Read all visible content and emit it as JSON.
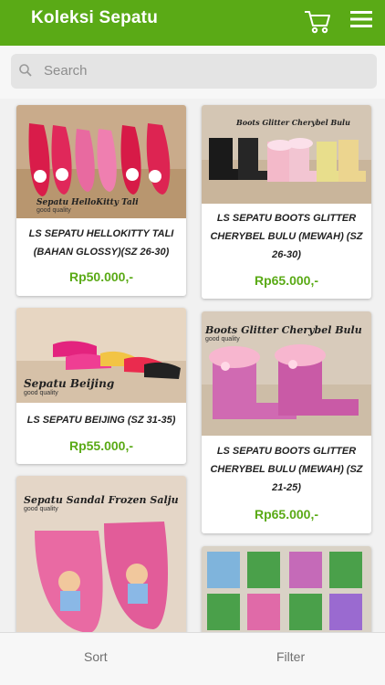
{
  "app": {
    "title": "Koleksi Sepatu",
    "cart_icon": "cart-icon",
    "menu_icon": "menu-icon"
  },
  "search": {
    "placeholder": "Search",
    "icon": "search-icon"
  },
  "products": [
    {
      "name": "LS SEPATU HELLOKITTY TALI (BAHAN GLOSSY)(SZ 26-30)",
      "price": "Rp50.000,-",
      "image_caption": "Sepatu HelloKitty Tali",
      "image_sub": "good quality"
    },
    {
      "name": "LS SEPATU BOOTS GLITTER CHERYBEL BULU (MEWAH) (SZ 26-30)",
      "price": "Rp65.000,-",
      "image_caption": "Boots Glitter Cherybel Bulu",
      "image_sub": ""
    },
    {
      "name": "LS SEPATU BEIJING (SZ 31-35)",
      "price": "Rp55.000,-",
      "image_caption": "Sepatu Beijing",
      "image_sub": "good quality"
    },
    {
      "name": "LS SEPATU BOOTS GLITTER CHERYBEL BULU (MEWAH) (SZ 21-25)",
      "price": "Rp65.000,-",
      "image_caption": "Boots Glitter Cherybel Bulu",
      "image_sub": "good quality"
    },
    {
      "name": "",
      "price": "",
      "image_caption": "Sepatu Sandal Frozen Salju",
      "image_sub": "good quality"
    },
    {
      "name": "",
      "price": "",
      "image_caption": "",
      "image_sub": ""
    }
  ],
  "bottom": {
    "sort_label": "Sort",
    "filter_label": "Filter"
  },
  "colors": {
    "brand": "#5aaa16",
    "price": "#5aaa16"
  }
}
